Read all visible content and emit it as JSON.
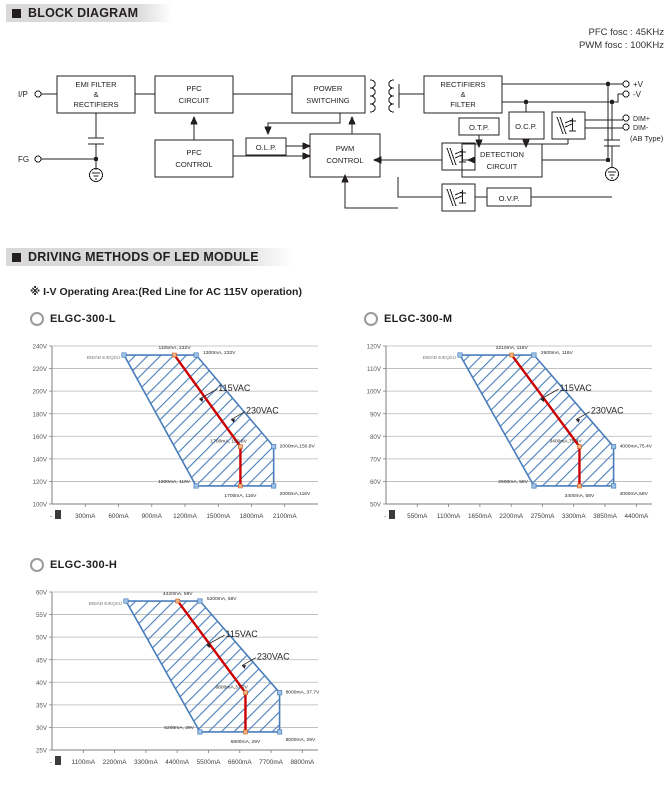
{
  "sections": {
    "block_diagram": "BLOCK DIAGRAM",
    "driving_methods": "DRIVING METHODS OF LED MODULE"
  },
  "fosc": {
    "pfc": "PFC fosc : 45KHz",
    "pwm": "PWM fosc : 100KHz"
  },
  "iv_note": "※ I-V  Operating Area:(Red Line for AC 115V operation)",
  "block_diagram": {
    "inputs": [
      {
        "label": "I/P"
      },
      {
        "label": "FG"
      }
    ],
    "blocks": [
      {
        "id": "emi",
        "lines": [
          "EMI FILTER",
          "&",
          "RECTIFIERS"
        ]
      },
      {
        "id": "pfc_circuit",
        "lines": [
          "PFC",
          "CIRCUIT"
        ]
      },
      {
        "id": "pfc_control",
        "lines": [
          "PFC",
          "CONTROL"
        ]
      },
      {
        "id": "power_switching",
        "lines": [
          "POWER",
          "SWITCHING"
        ]
      },
      {
        "id": "olp",
        "lines": [
          "O.L.P."
        ]
      },
      {
        "id": "pwm_control",
        "lines": [
          "PWM",
          "CONTROL"
        ]
      },
      {
        "id": "rectifiers_filter",
        "lines": [
          "RECTIFIERS",
          "&",
          "FILTER"
        ]
      },
      {
        "id": "otp",
        "lines": [
          "O.T.P."
        ]
      },
      {
        "id": "ocp",
        "lines": [
          "O.C.P."
        ]
      },
      {
        "id": "detection",
        "lines": [
          "DETECTION",
          "CIRCUIT"
        ]
      },
      {
        "id": "ovp",
        "lines": [
          "O.V.P."
        ]
      }
    ],
    "outputs": [
      {
        "label": "+V"
      },
      {
        "label": "-V"
      },
      {
        "label": "DIM+"
      },
      {
        "label": "DIM-"
      },
      {
        "label": "(AB Type)"
      }
    ]
  },
  "chart_data": [
    {
      "type": "area",
      "title": "ELGC-300-L",
      "xlabel": "",
      "ylabel": "",
      "xlim": [
        0,
        2400
      ],
      "ylim": [
        100,
        240
      ],
      "xticks": [
        "300mA",
        "600mA",
        "900mA",
        "1200mA",
        "1500mA",
        "1800mA",
        "2100mA"
      ],
      "xtick_values": [
        300,
        600,
        900,
        1200,
        1500,
        1800,
        2100
      ],
      "yticks": [
        "100V",
        "120V",
        "140V",
        "160V",
        "180V",
        "200V",
        "220V",
        "240V"
      ],
      "ytick_values": [
        100,
        120,
        140,
        160,
        180,
        200,
        220,
        240
      ],
      "grid": true,
      "legend": [
        "115VAC",
        "230VAC"
      ],
      "garbled_label": "ÐtÐÀÐ EÆÇÐÙ",
      "envelope": [
        {
          "ma": 650,
          "v": 232
        },
        {
          "ma": 1300,
          "v": 232
        },
        {
          "ma": 2000,
          "v": 150.8
        },
        {
          "ma": 2000,
          "v": 116
        },
        {
          "ma": 1300,
          "v": 116
        }
      ],
      "red_line": [
        {
          "ma": 1105,
          "v": 232
        },
        {
          "ma": 1700,
          "v": 150.8
        },
        {
          "ma": 1700,
          "v": 116
        }
      ],
      "annotations": [
        {
          "text": "1105mA, 232V",
          "ma": 1105,
          "v": 232
        },
        {
          "text": "1300mA, 232V",
          "ma": 1300,
          "v": 232
        },
        {
          "text": "115VAC",
          "ma": 1500,
          "v": 200
        },
        {
          "text": "230VAC",
          "ma": 1750,
          "v": 180
        },
        {
          "text": "1700mA, 150.8V",
          "ma": 1700,
          "v": 150.8
        },
        {
          "text": "2000mA,150.8V",
          "ma": 2000,
          "v": 150.8
        },
        {
          "text": "1300mA, 116V",
          "ma": 1300,
          "v": 116
        },
        {
          "text": "1700mA, 116V",
          "ma": 1700,
          "v": 116
        },
        {
          "text": "2000mA,116V",
          "ma": 2000,
          "v": 116
        }
      ]
    },
    {
      "type": "area",
      "title": "ELGC-300-M",
      "xlabel": "",
      "ylabel": "",
      "xlim": [
        0,
        4675
      ],
      "ylim": [
        50,
        120
      ],
      "xticks": [
        "550mA",
        "1100mA",
        "1650mA",
        "2200mA",
        "2750mA",
        "3300mA",
        "3850mA",
        "4400mA"
      ],
      "xtick_values": [
        550,
        1100,
        1650,
        2200,
        2750,
        3300,
        3850,
        4400
      ],
      "yticks": [
        "50V",
        "60V",
        "70V",
        "80V",
        "90V",
        "100V",
        "110V",
        "120V"
      ],
      "ytick_values": [
        50,
        60,
        70,
        80,
        90,
        100,
        110,
        120
      ],
      "grid": true,
      "legend": [
        "115VAC",
        "230VAC"
      ],
      "garbled_label": "ÐtÐÀÐ EÆÇÐÙ",
      "envelope": [
        {
          "ma": 1300,
          "v": 116
        },
        {
          "ma": 2600,
          "v": 116
        },
        {
          "ma": 4000,
          "v": 75.4
        },
        {
          "ma": 4000,
          "v": 58
        },
        {
          "ma": 2600,
          "v": 58
        }
      ],
      "red_line": [
        {
          "ma": 2210,
          "v": 116
        },
        {
          "ma": 3400,
          "v": 75.4
        },
        {
          "ma": 3400,
          "v": 58
        }
      ],
      "annotations": [
        {
          "text": "2210mA, 116V",
          "ma": 2210,
          "v": 116
        },
        {
          "text": "2600mA, 116V",
          "ma": 2600,
          "v": 116
        },
        {
          "text": "115VAC",
          "ma": 3050,
          "v": 100
        },
        {
          "text": "230VAC",
          "ma": 3600,
          "v": 90
        },
        {
          "text": "3400mA,75.4V",
          "ma": 3400,
          "v": 75.4
        },
        {
          "text": "4000mA,75.4V",
          "ma": 4000,
          "v": 75.4
        },
        {
          "text": "2600mA, 58V",
          "ma": 2600,
          "v": 58
        },
        {
          "text": "3400mA, 58V",
          "ma": 3400,
          "v": 58
        },
        {
          "text": "4000mA,58V",
          "ma": 4000,
          "v": 58
        }
      ]
    },
    {
      "type": "area",
      "title": "ELGC-300-H",
      "xlabel": "",
      "ylabel": "",
      "xlim": [
        0,
        9350
      ],
      "ylim": [
        25,
        60
      ],
      "xticks": [
        "1100mA",
        "2200mA",
        "3300mA",
        "4400mA",
        "5500mA",
        "6600mA",
        "7700mA",
        "8800mA"
      ],
      "xtick_values": [
        1100,
        2200,
        3300,
        4400,
        5500,
        6600,
        7700,
        8800
      ],
      "yticks": [
        "25V",
        "30V",
        "35V",
        "40V",
        "45V",
        "50V",
        "55V",
        "60V"
      ],
      "ytick_values": [
        25,
        30,
        35,
        40,
        45,
        50,
        55,
        60
      ],
      "grid": true,
      "legend": [
        "115VAC",
        "230VAC"
      ],
      "garbled_label": "ÐtÐÀÐ EÆÇÐÙ",
      "envelope": [
        {
          "ma": 2600,
          "v": 58
        },
        {
          "ma": 5200,
          "v": 58
        },
        {
          "ma": 8000,
          "v": 37.7
        },
        {
          "ma": 8000,
          "v": 29
        },
        {
          "ma": 5200,
          "v": 29
        }
      ],
      "red_line": [
        {
          "ma": 4420,
          "v": 58
        },
        {
          "ma": 6800,
          "v": 37.7
        },
        {
          "ma": 6800,
          "v": 29
        }
      ],
      "annotations": [
        {
          "text": "4420mA, 58V",
          "ma": 4420,
          "v": 58
        },
        {
          "text": "5200mA, 58V",
          "ma": 5200,
          "v": 58
        },
        {
          "text": "115VAC",
          "ma": 6100,
          "v": 50
        },
        {
          "text": "230VAC",
          "ma": 7200,
          "v": 45
        },
        {
          "text": "6800mA,37.7V",
          "ma": 6800,
          "v": 37.7
        },
        {
          "text": "8000mA, 37.7V",
          "ma": 8000,
          "v": 37.7
        },
        {
          "text": "5200mA, 29V",
          "ma": 5200,
          "v": 29
        },
        {
          "text": "6800mA, 29V",
          "ma": 6800,
          "v": 29
        },
        {
          "text": "8000mA, 29V",
          "ma": 8000,
          "v": 29
        }
      ]
    }
  ],
  "colors": {
    "hatch_blue": "#4A7EBB",
    "red_line": "#CC0000",
    "grid": "#b7b7b7",
    "axis": "#7f7f7f",
    "header_bg": "#d9d9d9",
    "text": "#231f20"
  }
}
